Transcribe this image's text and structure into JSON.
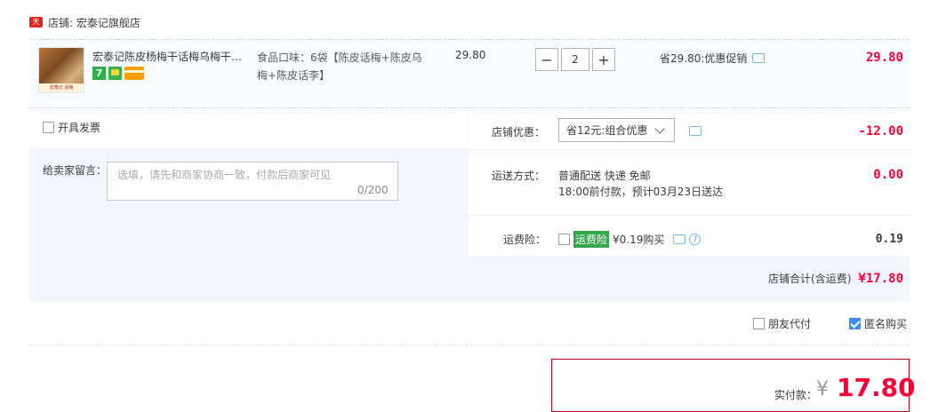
{
  "shop": {
    "badge": "天猫",
    "label": "店铺: 宏泰记旗舰店"
  },
  "item": {
    "image_caption": "宏泰记 话梅",
    "title": "宏泰记陈皮杨梅干话梅乌梅干蜜...",
    "icons": [
      "seven-day-icon",
      "shield-icon",
      "card-icon"
    ],
    "seven_text": "7",
    "sku": "食品口味：6袋【陈皮话梅+陈皮乌梅+陈皮话李】",
    "price": "29.80",
    "quantity": "2",
    "minus": "−",
    "plus": "+",
    "promo": "省29.80:优惠促销",
    "total": "29.80"
  },
  "invoice": {
    "label": "开具发票"
  },
  "message": {
    "label": "给卖家留言：",
    "placeholder": "选填，请先和商家协商一致，付款后商家可见",
    "count": "0/200"
  },
  "discount": {
    "label": "店铺优惠：",
    "selected": "省12元:组合优惠",
    "amount": "-12.00"
  },
  "shipping": {
    "label": "运送方式：",
    "line1": "普通配送 快递 免邮",
    "line2": "18:00前付款，预计03月23日送达",
    "amount": "0.00"
  },
  "insurance": {
    "label": "运费险：",
    "tag": "运费险",
    "text": "¥0.19购买",
    "amount": "0.19"
  },
  "shop_total": {
    "label": "店铺合计(含运费)",
    "amount": "¥17.80"
  },
  "options": {
    "friend_pay": "朋友代付",
    "anonymous": "匿名购买"
  },
  "payment": {
    "label": "实付款：",
    "yen": "¥",
    "amount": "17.80"
  },
  "colors": {
    "accent_red": "#ff0036",
    "panel_blue": "#f2f7ff",
    "check_blue": "#3d8ef7",
    "green": "#31a849"
  }
}
